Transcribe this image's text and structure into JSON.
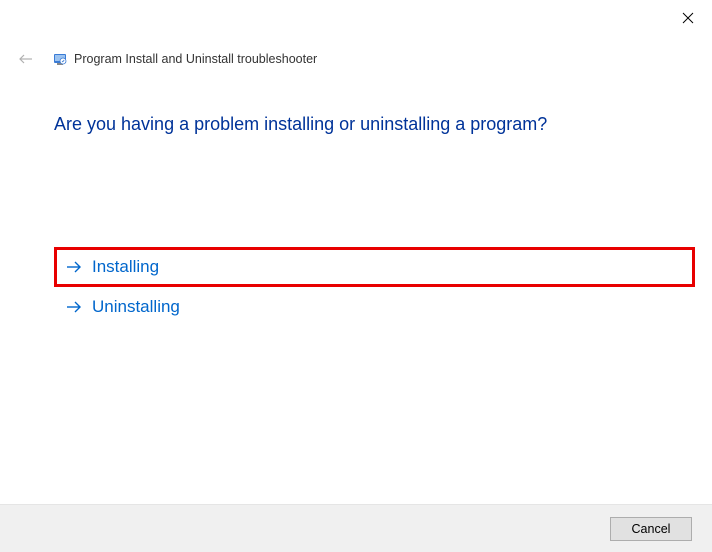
{
  "header": {
    "title": "Program Install and Uninstall troubleshooter"
  },
  "main": {
    "question": "Are you having a problem installing or uninstalling a program?",
    "options": [
      {
        "label": "Installing",
        "highlighted": true
      },
      {
        "label": "Uninstalling",
        "highlighted": false
      }
    ]
  },
  "footer": {
    "cancel_label": "Cancel"
  },
  "colors": {
    "link": "#0066CC",
    "heading": "#003399",
    "highlight_border": "#E80000"
  }
}
